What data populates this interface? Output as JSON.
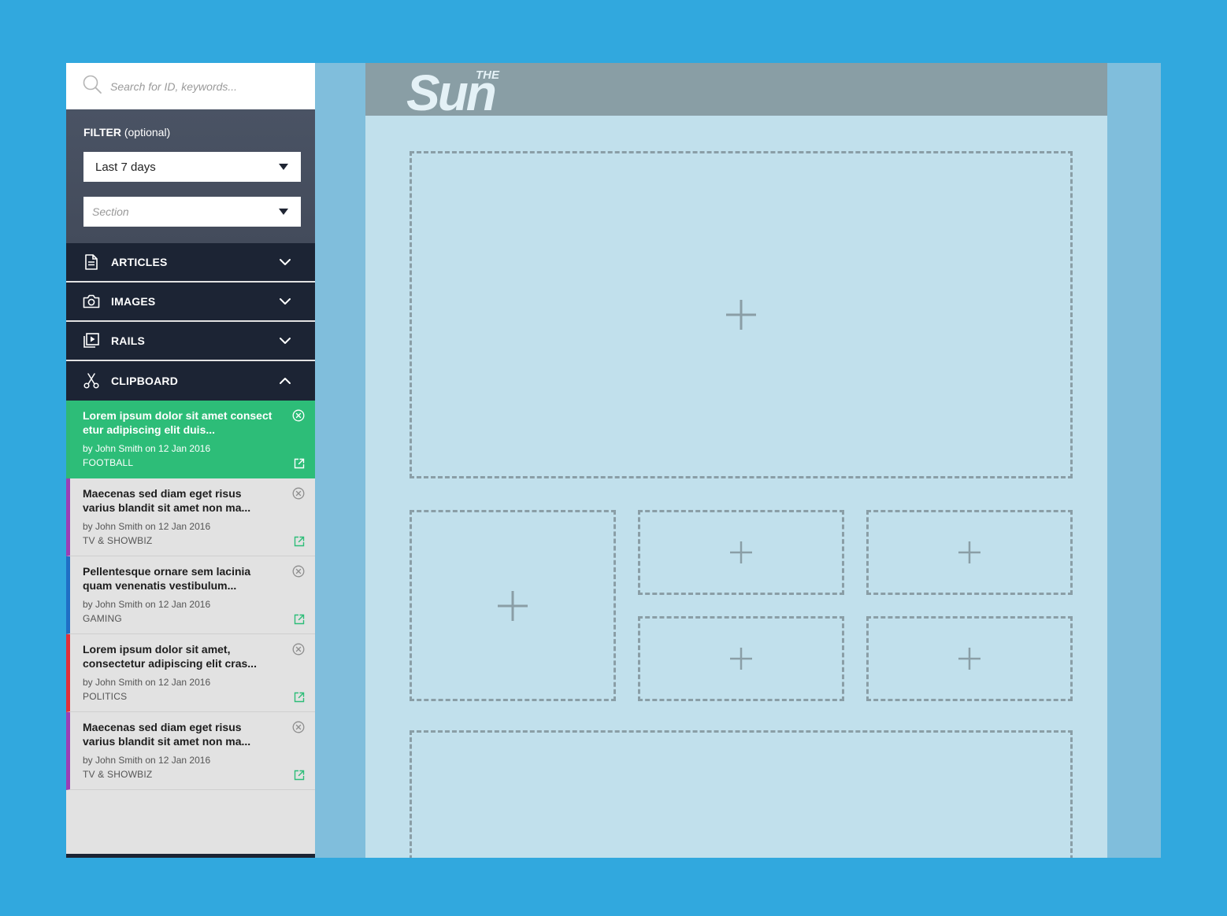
{
  "search": {
    "placeholder": "Search for ID, keywords..."
  },
  "filter": {
    "label_bold": "FILTER",
    "label_suffix": " (optional)",
    "date_range": "Last 7 days",
    "section_placeholder": "Section"
  },
  "accordion": {
    "articles": "ARTICLES",
    "images": "IMAGES",
    "rails": "RAILS",
    "clipboard": "CLIPBOARD"
  },
  "clipboard_items": [
    {
      "title": "Lorem ipsum dolor sit amet consect etur adipiscing elit duis...",
      "meta": "by John Smith on 12 Jan 2016",
      "section": "FOOTBALL",
      "color": "#2fb875",
      "active": true
    },
    {
      "title": "Maecenas sed diam eget risus varius blandit sit amet non ma...",
      "meta": "by John Smith on 12 Jan 2016",
      "section": "TV & SHOWBIZ",
      "color": "#9b3fb5",
      "active": false
    },
    {
      "title": "Pellentesque ornare sem lacinia quam venenatis vestibulum...",
      "meta": "by John Smith on 12 Jan 2016",
      "section": "GAMING",
      "color": "#1f6fc5",
      "active": false
    },
    {
      "title": "Lorem ipsum dolor sit amet, consectetur adipiscing elit cras...",
      "meta": "by John Smith on 12 Jan 2016",
      "section": "POLITICS",
      "color": "#e0303a",
      "active": false
    },
    {
      "title": "Maecenas sed diam eget risus varius blandit sit amet non ma...",
      "meta": "by John Smith on 12 Jan 2016",
      "section": "TV & SHOWBIZ",
      "color": "#9b3fb5",
      "active": false
    }
  ],
  "masthead": {
    "logo_top": "THE",
    "logo_main": "Sun"
  },
  "colors": {
    "background": "#31a8de",
    "nav_dark": "#1c2434",
    "active_green": "#2dbd78",
    "page": "#c1e0ec",
    "masthead": "#899ea5",
    "slot_border": "#8a9ea6"
  },
  "icons": {
    "search": "search-icon",
    "articles": "document-icon",
    "images": "camera-icon",
    "rails": "play-stack-icon",
    "clipboard": "scissors-icon",
    "remove": "close-circle-icon",
    "open": "external-link-icon",
    "add": "plus-icon"
  }
}
